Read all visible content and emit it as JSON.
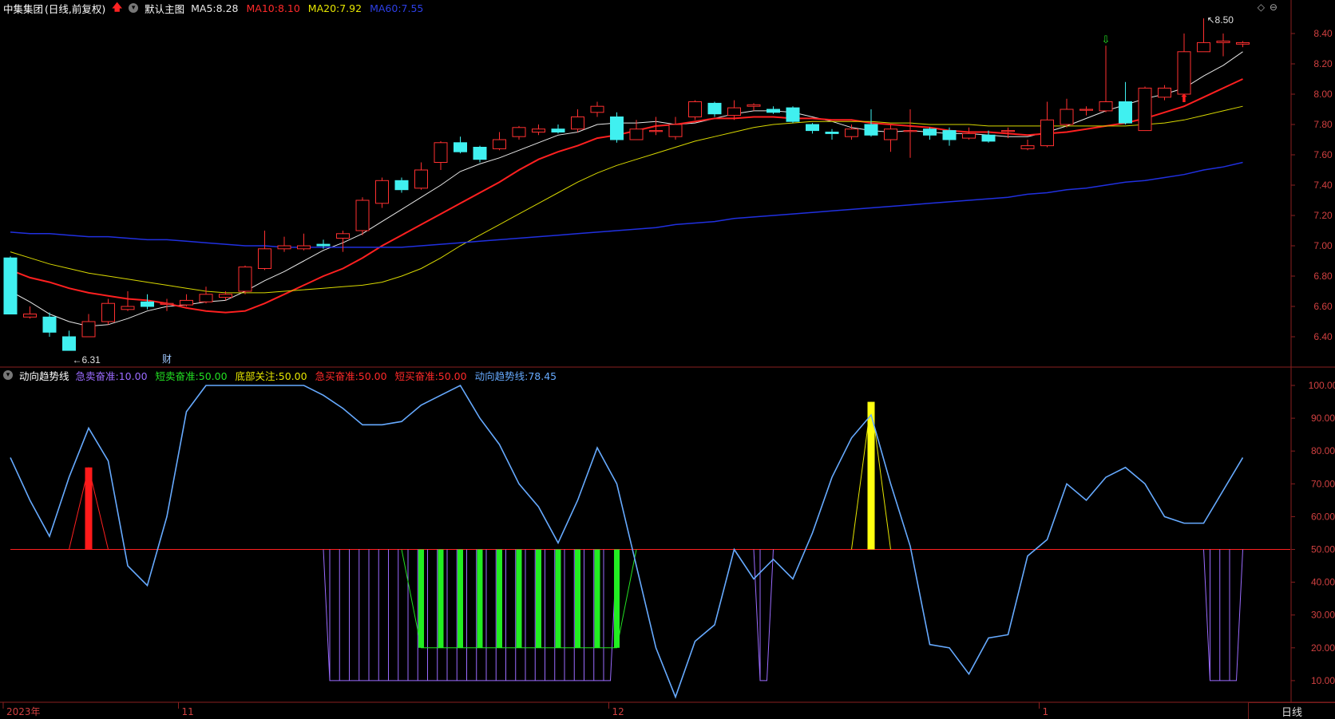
{
  "main": {
    "stock_name": "中集集团",
    "period": "(日线,前复权)",
    "template_name": "默认主图",
    "ma": [
      {
        "label": "MA5:",
        "value": "8.28",
        "color": "#e8e8e8"
      },
      {
        "label": "MA10:",
        "value": "8.10",
        "color": "#ff2a2a"
      },
      {
        "label": "MA20:",
        "value": "7.92",
        "color": "#e6e600"
      },
      {
        "label": "MA60:",
        "value": "7.55",
        "color": "#2d3fe6"
      }
    ],
    "price_ticks": [
      "8.40",
      "8.20",
      "8.00",
      "7.80",
      "7.60",
      "7.40",
      "7.20",
      "7.00",
      "6.80",
      "6.60",
      "6.40"
    ],
    "high_marker": "8.50",
    "low_marker": "6.31",
    "fin_marker": "财"
  },
  "candles": [
    [
      6.92,
      6.55,
      6.93,
      6.55
    ],
    [
      6.53,
      6.55,
      6.6,
      6.52
    ],
    [
      6.53,
      6.43,
      6.56,
      6.4
    ],
    [
      6.4,
      6.31,
      6.44,
      6.31
    ],
    [
      6.4,
      6.5,
      6.55,
      6.4
    ],
    [
      6.5,
      6.62,
      6.65,
      6.48
    ],
    [
      6.58,
      6.6,
      6.7,
      6.57
    ],
    [
      6.63,
      6.6,
      6.68,
      6.58
    ],
    [
      6.62,
      6.62,
      6.65,
      6.57
    ],
    [
      6.61,
      6.64,
      6.68,
      6.6
    ],
    [
      6.63,
      6.68,
      6.73,
      6.62
    ],
    [
      6.66,
      6.68,
      6.7,
      6.64
    ],
    [
      6.7,
      6.86,
      6.87,
      6.68
    ],
    [
      6.85,
      6.98,
      7.1,
      6.84
    ],
    [
      6.98,
      7.0,
      7.06,
      6.96
    ],
    [
      6.98,
      7.0,
      7.08,
      6.97
    ],
    [
      7.01,
      7.0,
      7.04,
      6.98
    ],
    [
      7.05,
      7.08,
      7.1,
      6.96
    ],
    [
      7.1,
      7.3,
      7.32,
      7.07
    ],
    [
      7.28,
      7.43,
      7.45,
      7.25
    ],
    [
      7.43,
      7.37,
      7.45,
      7.35
    ],
    [
      7.38,
      7.5,
      7.55,
      7.37
    ],
    [
      7.55,
      7.68,
      7.69,
      7.5
    ],
    [
      7.68,
      7.62,
      7.72,
      7.61
    ],
    [
      7.65,
      7.57,
      7.66,
      7.55
    ],
    [
      7.64,
      7.7,
      7.75,
      7.63
    ],
    [
      7.72,
      7.78,
      7.79,
      7.7
    ],
    [
      7.75,
      7.77,
      7.8,
      7.73
    ],
    [
      7.77,
      7.75,
      7.8,
      7.74
    ],
    [
      7.77,
      7.85,
      7.9,
      7.75
    ],
    [
      7.88,
      7.92,
      7.95,
      7.85
    ],
    [
      7.85,
      7.7,
      7.88,
      7.68
    ],
    [
      7.7,
      7.77,
      7.83,
      7.7
    ],
    [
      7.76,
      7.76,
      7.85,
      7.73
    ],
    [
      7.72,
      7.8,
      7.85,
      7.7
    ],
    [
      7.85,
      7.95,
      7.96,
      7.83
    ],
    [
      7.94,
      7.87,
      7.95,
      7.85
    ],
    [
      7.86,
      7.91,
      7.96,
      7.83
    ],
    [
      7.92,
      7.93,
      7.94,
      7.89
    ],
    [
      7.9,
      7.88,
      7.92,
      7.87
    ],
    [
      7.91,
      7.82,
      7.92,
      7.81
    ],
    [
      7.8,
      7.76,
      7.81,
      7.74
    ],
    [
      7.75,
      7.74,
      7.77,
      7.7
    ],
    [
      7.72,
      7.77,
      7.8,
      7.7
    ],
    [
      7.8,
      7.73,
      7.9,
      7.72
    ],
    [
      7.7,
      7.77,
      7.8,
      7.62
    ],
    [
      7.76,
      7.76,
      7.9,
      7.58
    ],
    [
      7.77,
      7.73,
      7.78,
      7.7
    ],
    [
      7.76,
      7.7,
      7.78,
      7.66
    ],
    [
      7.71,
      7.74,
      7.78,
      7.7
    ],
    [
      7.73,
      7.69,
      7.76,
      7.68
    ],
    [
      7.76,
      7.76,
      7.78,
      7.71
    ],
    [
      7.64,
      7.66,
      7.7,
      7.63
    ],
    [
      7.66,
      7.83,
      7.95,
      7.65
    ],
    [
      7.8,
      7.9,
      7.97,
      7.78
    ],
    [
      7.9,
      7.9,
      7.92,
      7.86
    ],
    [
      7.89,
      7.95,
      8.32,
      7.88
    ],
    [
      7.95,
      7.81,
      8.08,
      7.8
    ],
    [
      7.76,
      8.04,
      8.05,
      7.76
    ],
    [
      7.98,
      8.04,
      8.06,
      7.96
    ],
    [
      8.0,
      8.28,
      8.4,
      7.98
    ],
    [
      8.28,
      8.34,
      8.5,
      8.28
    ],
    [
      8.34,
      8.35,
      8.4,
      8.25
    ],
    [
      8.33,
      8.34,
      8.35,
      8.31
    ]
  ],
  "ma_series": {
    "ma5": [
      6.7,
      6.63,
      6.55,
      6.5,
      6.47,
      6.48,
      6.52,
      6.57,
      6.6,
      6.61,
      6.63,
      6.64,
      6.7,
      6.77,
      6.83,
      6.9,
      6.97,
      7.02,
      7.08,
      7.16,
      7.24,
      7.32,
      7.4,
      7.49,
      7.54,
      7.58,
      7.63,
      7.68,
      7.73,
      7.75,
      7.8,
      7.81,
      7.81,
      7.82,
      7.8,
      7.81,
      7.84,
      7.87,
      7.89,
      7.89,
      7.88,
      7.85,
      7.82,
      7.78,
      7.76,
      7.75,
      7.76,
      7.75,
      7.74,
      7.74,
      7.73,
      7.72,
      7.72,
      7.75,
      7.79,
      7.84,
      7.89,
      7.93,
      7.97,
      8.0,
      8.04,
      8.12,
      8.19,
      8.28
    ],
    "ma10": [
      6.84,
      6.79,
      6.76,
      6.72,
      6.69,
      6.67,
      6.65,
      6.64,
      6.62,
      6.59,
      6.57,
      6.56,
      6.57,
      6.62,
      6.68,
      6.74,
      6.8,
      6.85,
      6.92,
      7.0,
      7.07,
      7.14,
      7.21,
      7.28,
      7.35,
      7.42,
      7.5,
      7.57,
      7.62,
      7.66,
      7.71,
      7.73,
      7.76,
      7.79,
      7.8,
      7.82,
      7.84,
      7.84,
      7.85,
      7.85,
      7.84,
      7.84,
      7.83,
      7.83,
      7.81,
      7.8,
      7.79,
      7.78,
      7.76,
      7.75,
      7.75,
      7.74,
      7.73,
      7.74,
      7.75,
      7.77,
      7.79,
      7.81,
      7.84,
      7.88,
      7.92,
      7.98,
      8.04,
      8.1
    ],
    "ma20": [
      6.96,
      6.92,
      6.88,
      6.85,
      6.82,
      6.8,
      6.78,
      6.76,
      6.74,
      6.72,
      6.7,
      6.69,
      6.69,
      6.69,
      6.7,
      6.71,
      6.72,
      6.73,
      6.74,
      6.76,
      6.8,
      6.85,
      6.92,
      7.0,
      7.07,
      7.14,
      7.21,
      7.28,
      7.35,
      7.42,
      7.48,
      7.53,
      7.57,
      7.61,
      7.65,
      7.69,
      7.72,
      7.75,
      7.78,
      7.8,
      7.81,
      7.82,
      7.82,
      7.82,
      7.82,
      7.81,
      7.81,
      7.8,
      7.8,
      7.8,
      7.79,
      7.79,
      7.79,
      7.79,
      7.79,
      7.79,
      7.79,
      7.79,
      7.8,
      7.81,
      7.83,
      7.86,
      7.89,
      7.92
    ],
    "ma60": [
      7.09,
      7.08,
      7.08,
      7.07,
      7.06,
      7.06,
      7.05,
      7.04,
      7.04,
      7.03,
      7.02,
      7.01,
      7.0,
      7.0,
      6.99,
      6.99,
      6.99,
      6.99,
      6.99,
      6.99,
      6.99,
      7.0,
      7.01,
      7.02,
      7.03,
      7.04,
      7.05,
      7.06,
      7.07,
      7.08,
      7.09,
      7.1,
      7.11,
      7.12,
      7.14,
      7.15,
      7.16,
      7.18,
      7.19,
      7.2,
      7.21,
      7.22,
      7.23,
      7.24,
      7.25,
      7.26,
      7.27,
      7.28,
      7.29,
      7.3,
      7.31,
      7.32,
      7.34,
      7.35,
      7.37,
      7.38,
      7.4,
      7.42,
      7.43,
      7.45,
      7.47,
      7.5,
      7.52,
      7.55
    ]
  },
  "indicator": {
    "name": "动向趋势线",
    "params": [
      {
        "label": "急卖奋准:",
        "value": "10.00",
        "color": "#9b6bff"
      },
      {
        "label": "短卖奋准:",
        "value": "50.00",
        "color": "#22e022"
      },
      {
        "label": "底部关注:",
        "value": "50.00",
        "color": "#e6e600"
      },
      {
        "label": "急买奋准:",
        "value": "50.00",
        "color": "#ff2a2a"
      },
      {
        "label": "短买奋准:",
        "value": "50.00",
        "color": "#ff2a2a"
      },
      {
        "label": "动向趋势线:",
        "value": "78.45",
        "color": "#66aaff"
      }
    ],
    "ticks": [
      "100.00",
      "90.00",
      "80.00",
      "70.00",
      "60.00",
      "50.00",
      "40.00",
      "30.00",
      "20.00",
      "10.00"
    ],
    "line": [
      78,
      65,
      54,
      72,
      87,
      77,
      45,
      39,
      60,
      92,
      100,
      100,
      100,
      100,
      100,
      100,
      97,
      93,
      88,
      88,
      89,
      94,
      97,
      100,
      90,
      82,
      70,
      63,
      52,
      65,
      81,
      70,
      45,
      20,
      5,
      22,
      27,
      50,
      41,
      47,
      41,
      55,
      72,
      84,
      91,
      70,
      51,
      21,
      20,
      12,
      23,
      24,
      48,
      53,
      70,
      65,
      72,
      75,
      70,
      60,
      58,
      58,
      68,
      78
    ],
    "red_bars": [
      {
        "i": 4,
        "v": 75
      }
    ],
    "yellow_bars": [
      {
        "i": 44,
        "v": 95
      }
    ],
    "green_bars": [
      21,
      22,
      23,
      24,
      25,
      26,
      27,
      28,
      29,
      30,
      31
    ],
    "purple_zones": [
      [
        16,
        31
      ],
      [
        38,
        39
      ],
      [
        61,
        63
      ]
    ]
  },
  "time_axis": {
    "labels": [
      {
        "i": 0,
        "text": "2023年"
      },
      {
        "i": 9,
        "text": "11"
      },
      {
        "i": 31,
        "text": "12"
      },
      {
        "i": 53,
        "text": "1"
      }
    ],
    "period_button": "日线"
  }
}
